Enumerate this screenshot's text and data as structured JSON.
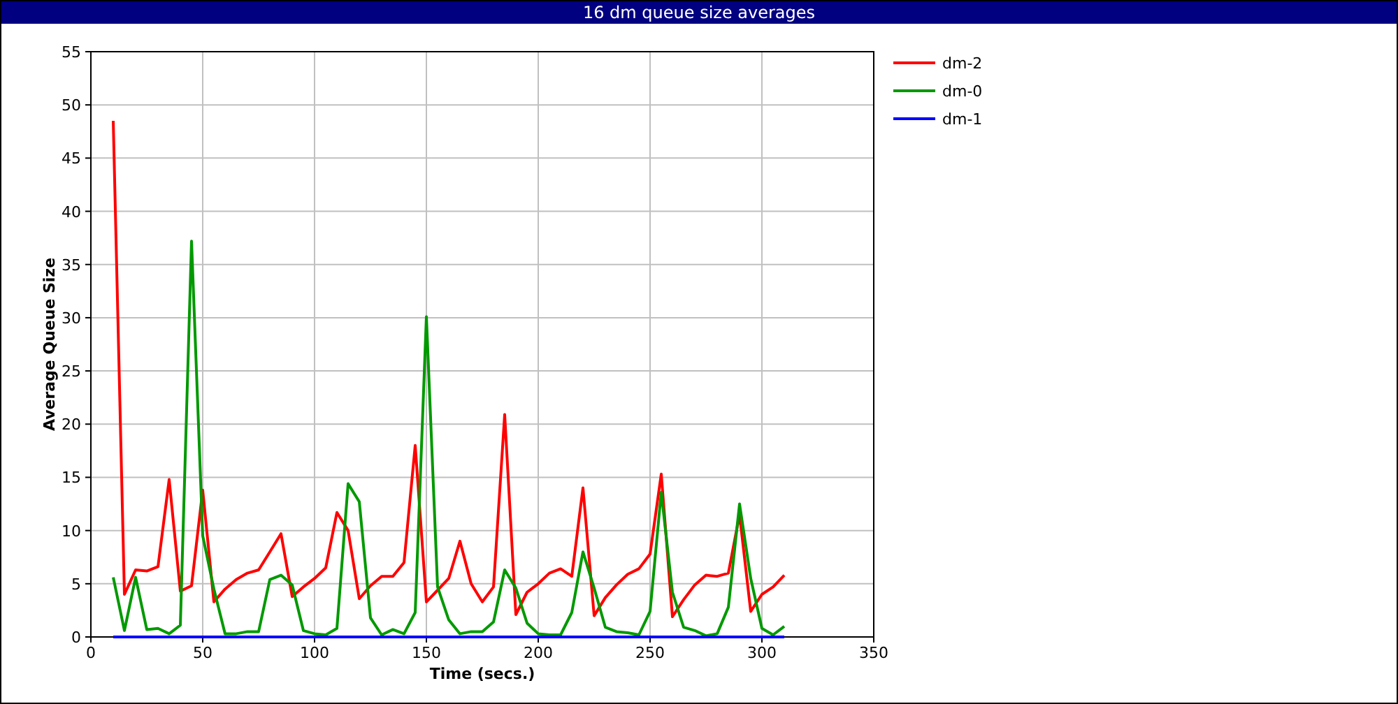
{
  "window": {
    "title": "16 dm queue size averages"
  },
  "chart": {
    "chart_data": {
      "type": "line",
      "grid": true,
      "legend": true,
      "xlabel": "Time (secs.)",
      "ylabel": "Average Queue Size",
      "xlim": [
        0,
        350
      ],
      "ylim": [
        0,
        55
      ],
      "xticks": [
        0,
        50,
        100,
        150,
        200,
        250,
        300,
        350
      ],
      "yticks": [
        0,
        5,
        10,
        15,
        20,
        25,
        30,
        35,
        40,
        45,
        50,
        55
      ],
      "x": [
        10,
        15,
        20,
        25,
        30,
        35,
        40,
        45,
        50,
        55,
        60,
        65,
        70,
        75,
        80,
        85,
        90,
        95,
        100,
        105,
        110,
        115,
        120,
        125,
        130,
        135,
        140,
        145,
        150,
        155,
        160,
        165,
        170,
        175,
        180,
        185,
        190,
        195,
        200,
        205,
        210,
        215,
        220,
        225,
        230,
        235,
        240,
        245,
        250,
        255,
        260,
        265,
        270,
        275,
        280,
        285,
        290,
        295,
        300,
        305,
        310
      ],
      "series": [
        {
          "name": "dm-2",
          "color": "#ff0000",
          "values": [
            48.5,
            4,
            6.3,
            6.2,
            6.6,
            14.8,
            4.3,
            4.8,
            13.8,
            3.3,
            4.5,
            5.4,
            6,
            6.3,
            8,
            9.7,
            3.8,
            4.7,
            5.5,
            6.5,
            11.7,
            10,
            3.6,
            4.8,
            5.7,
            5.7,
            7,
            18,
            3.3,
            4.4,
            5.5,
            9,
            5,
            3.3,
            4.7,
            20.9,
            2.1,
            4.2,
            5,
            6,
            6.4,
            5.7,
            14,
            2,
            3.7,
            4.9,
            5.9,
            6.4,
            7.8,
            15.3,
            1.9,
            3.5,
            4.9,
            5.8,
            5.7,
            6,
            11.5,
            2.4,
            4,
            4.7,
            5.8
          ]
        },
        {
          "name": "dm-0",
          "color": "#009900",
          "values": [
            5.6,
            0.6,
            5.6,
            0.7,
            0.8,
            0.3,
            1.1,
            37.2,
            9.5,
            4.5,
            0.3,
            0.3,
            0.5,
            0.5,
            5.4,
            5.8,
            4.9,
            0.6,
            0.3,
            0.2,
            0.8,
            14.4,
            12.7,
            1.8,
            0.2,
            0.7,
            0.3,
            2.3,
            30.1,
            4.7,
            1.6,
            0.3,
            0.5,
            0.5,
            1.4,
            6.3,
            4.6,
            1.3,
            0.3,
            0.2,
            0.2,
            2.3,
            8,
            4.6,
            0.9,
            0.5,
            0.4,
            0.2,
            2.4,
            13.6,
            4.2,
            0.9,
            0.6,
            0.1,
            0.3,
            2.8,
            12.5,
            5.5,
            0.8,
            0.2,
            1
          ]
        },
        {
          "name": "dm-1",
          "color": "#0000ff",
          "values": [
            0,
            0,
            0,
            0,
            0,
            0,
            0,
            0,
            0,
            0,
            0,
            0,
            0,
            0,
            0,
            0,
            0,
            0,
            0,
            0,
            0,
            0,
            0,
            0,
            0,
            0,
            0,
            0,
            0,
            0,
            0,
            0,
            0,
            0,
            0,
            0,
            0,
            0,
            0,
            0,
            0,
            0,
            0,
            0,
            0,
            0,
            0,
            0,
            0,
            0,
            0,
            0,
            0,
            0,
            0,
            0,
            0,
            0,
            0,
            0,
            0
          ]
        }
      ]
    }
  }
}
